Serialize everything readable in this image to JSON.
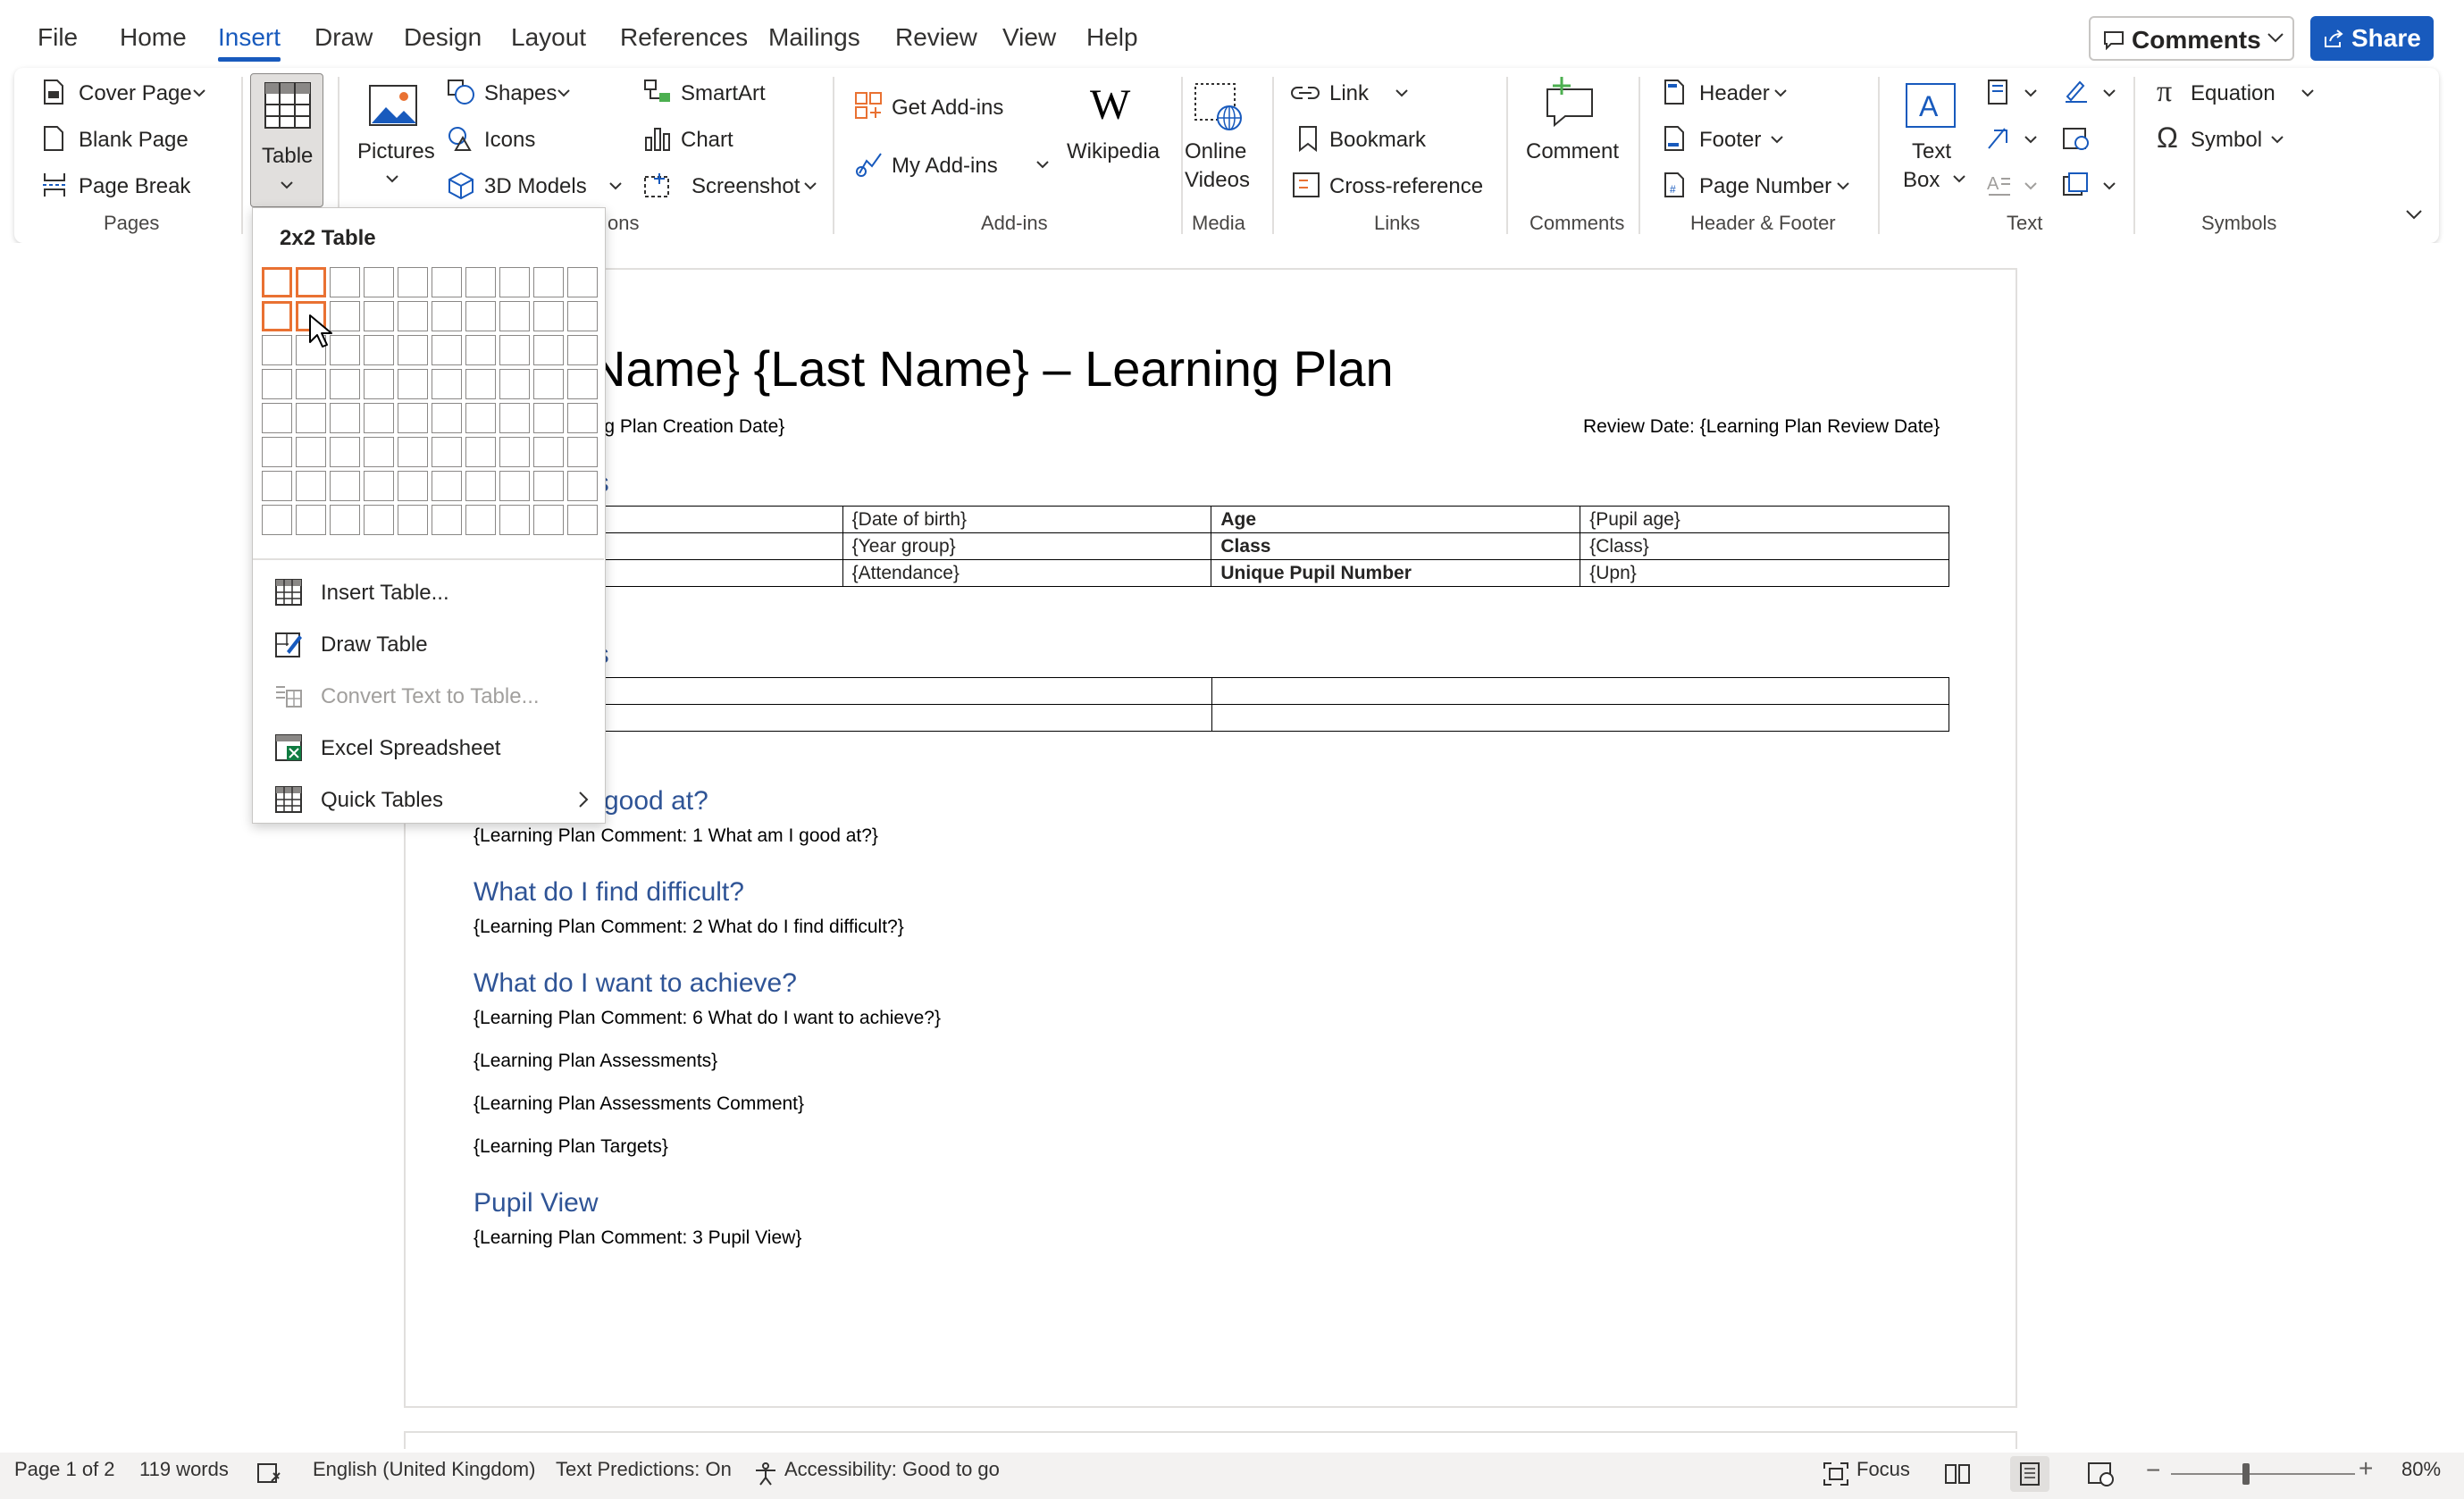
{
  "menu": {
    "file": "File",
    "home": "Home",
    "insert": "Insert",
    "draw": "Draw",
    "design": "Design",
    "layout": "Layout",
    "references": "References",
    "mailings": "Mailings",
    "review": "Review",
    "view": "View",
    "help": "Help",
    "comments": "Comments",
    "share": "Share"
  },
  "ribbon": {
    "pages": {
      "cover_page": "Cover Page",
      "blank_page": "Blank Page",
      "page_break": "Page Break",
      "label": "Pages"
    },
    "table": {
      "label": "Table"
    },
    "illustrations": {
      "pictures": "Pictures",
      "shapes": "Shapes",
      "icons": "Icons",
      "models": "3D Models",
      "smartart": "SmartArt",
      "chart": "Chart",
      "screenshot": "Screenshot",
      "label_partial": "ons"
    },
    "addins": {
      "get": "Get Add-ins",
      "my": "My Add-ins",
      "wikipedia": "Wikipedia",
      "label": "Add-ins"
    },
    "media": {
      "online": "Online",
      "videos": "Videos",
      "label": "Media"
    },
    "links": {
      "link": "Link",
      "bookmark": "Bookmark",
      "crossref": "Cross-reference",
      "label": "Links"
    },
    "comments": {
      "comment": "Comment",
      "label": "Comments"
    },
    "header_footer": {
      "header": "Header",
      "footer": "Footer",
      "page_number": "Page Number",
      "label": "Header & Footer"
    },
    "text": {
      "text_box_1": "Text",
      "text_box_2": "Box",
      "label": "Text"
    },
    "symbols": {
      "equation": "Equation",
      "symbol": "Symbol",
      "label": "Symbols"
    }
  },
  "table_dropdown": {
    "title": "2x2 Table",
    "insert_table": "Insert Table...",
    "draw_table": "Draw Table",
    "convert": "Convert Text to Table...",
    "excel": "Excel Spreadsheet",
    "quick": "Quick Tables"
  },
  "document": {
    "title": "Name} {Last Name} – Learning Plan",
    "creation": "ing Plan Creation Date}",
    "review": "Review Date: {Learning Plan Review Date}",
    "section1": "ls",
    "table1": [
      [
        "",
        "{Date of birth}",
        "Age",
        "{Pupil age}"
      ],
      [
        "",
        "{Year group}",
        "Class",
        "{Class}"
      ],
      [
        "",
        "{Attendance}",
        "Unique Pupil Number",
        "{Upn}"
      ]
    ],
    "section2": "ls",
    "h_good": "good at?",
    "p_good": "{Learning Plan Comment: 1 What am I good at?}",
    "h_difficult": "What do I find difficult?",
    "p_difficult": "{Learning Plan Comment: 2 What do I find difficult?}",
    "h_achieve": "What do I want to achieve?",
    "p_achieve": "{Learning Plan Comment: 6 What do I want to achieve?}",
    "p_assess": "{Learning Plan Assessments}",
    "p_assess_comment": "{Learning Plan Assessments Comment}",
    "p_targets": "{Learning Plan Targets}",
    "h_pupil": "Pupil View",
    "p_pupil": "{Learning Plan Comment: 3 Pupil View}"
  },
  "status": {
    "page": "Page 1 of 2",
    "words": "119 words",
    "language": "English (United Kingdom)",
    "predictions": "Text Predictions: On",
    "accessibility": "Accessibility: Good to go",
    "focus": "Focus",
    "zoom": "80%"
  },
  "colors": {
    "accent": "#185abd",
    "selection": "#e97132",
    "heading": "#2f5496"
  }
}
